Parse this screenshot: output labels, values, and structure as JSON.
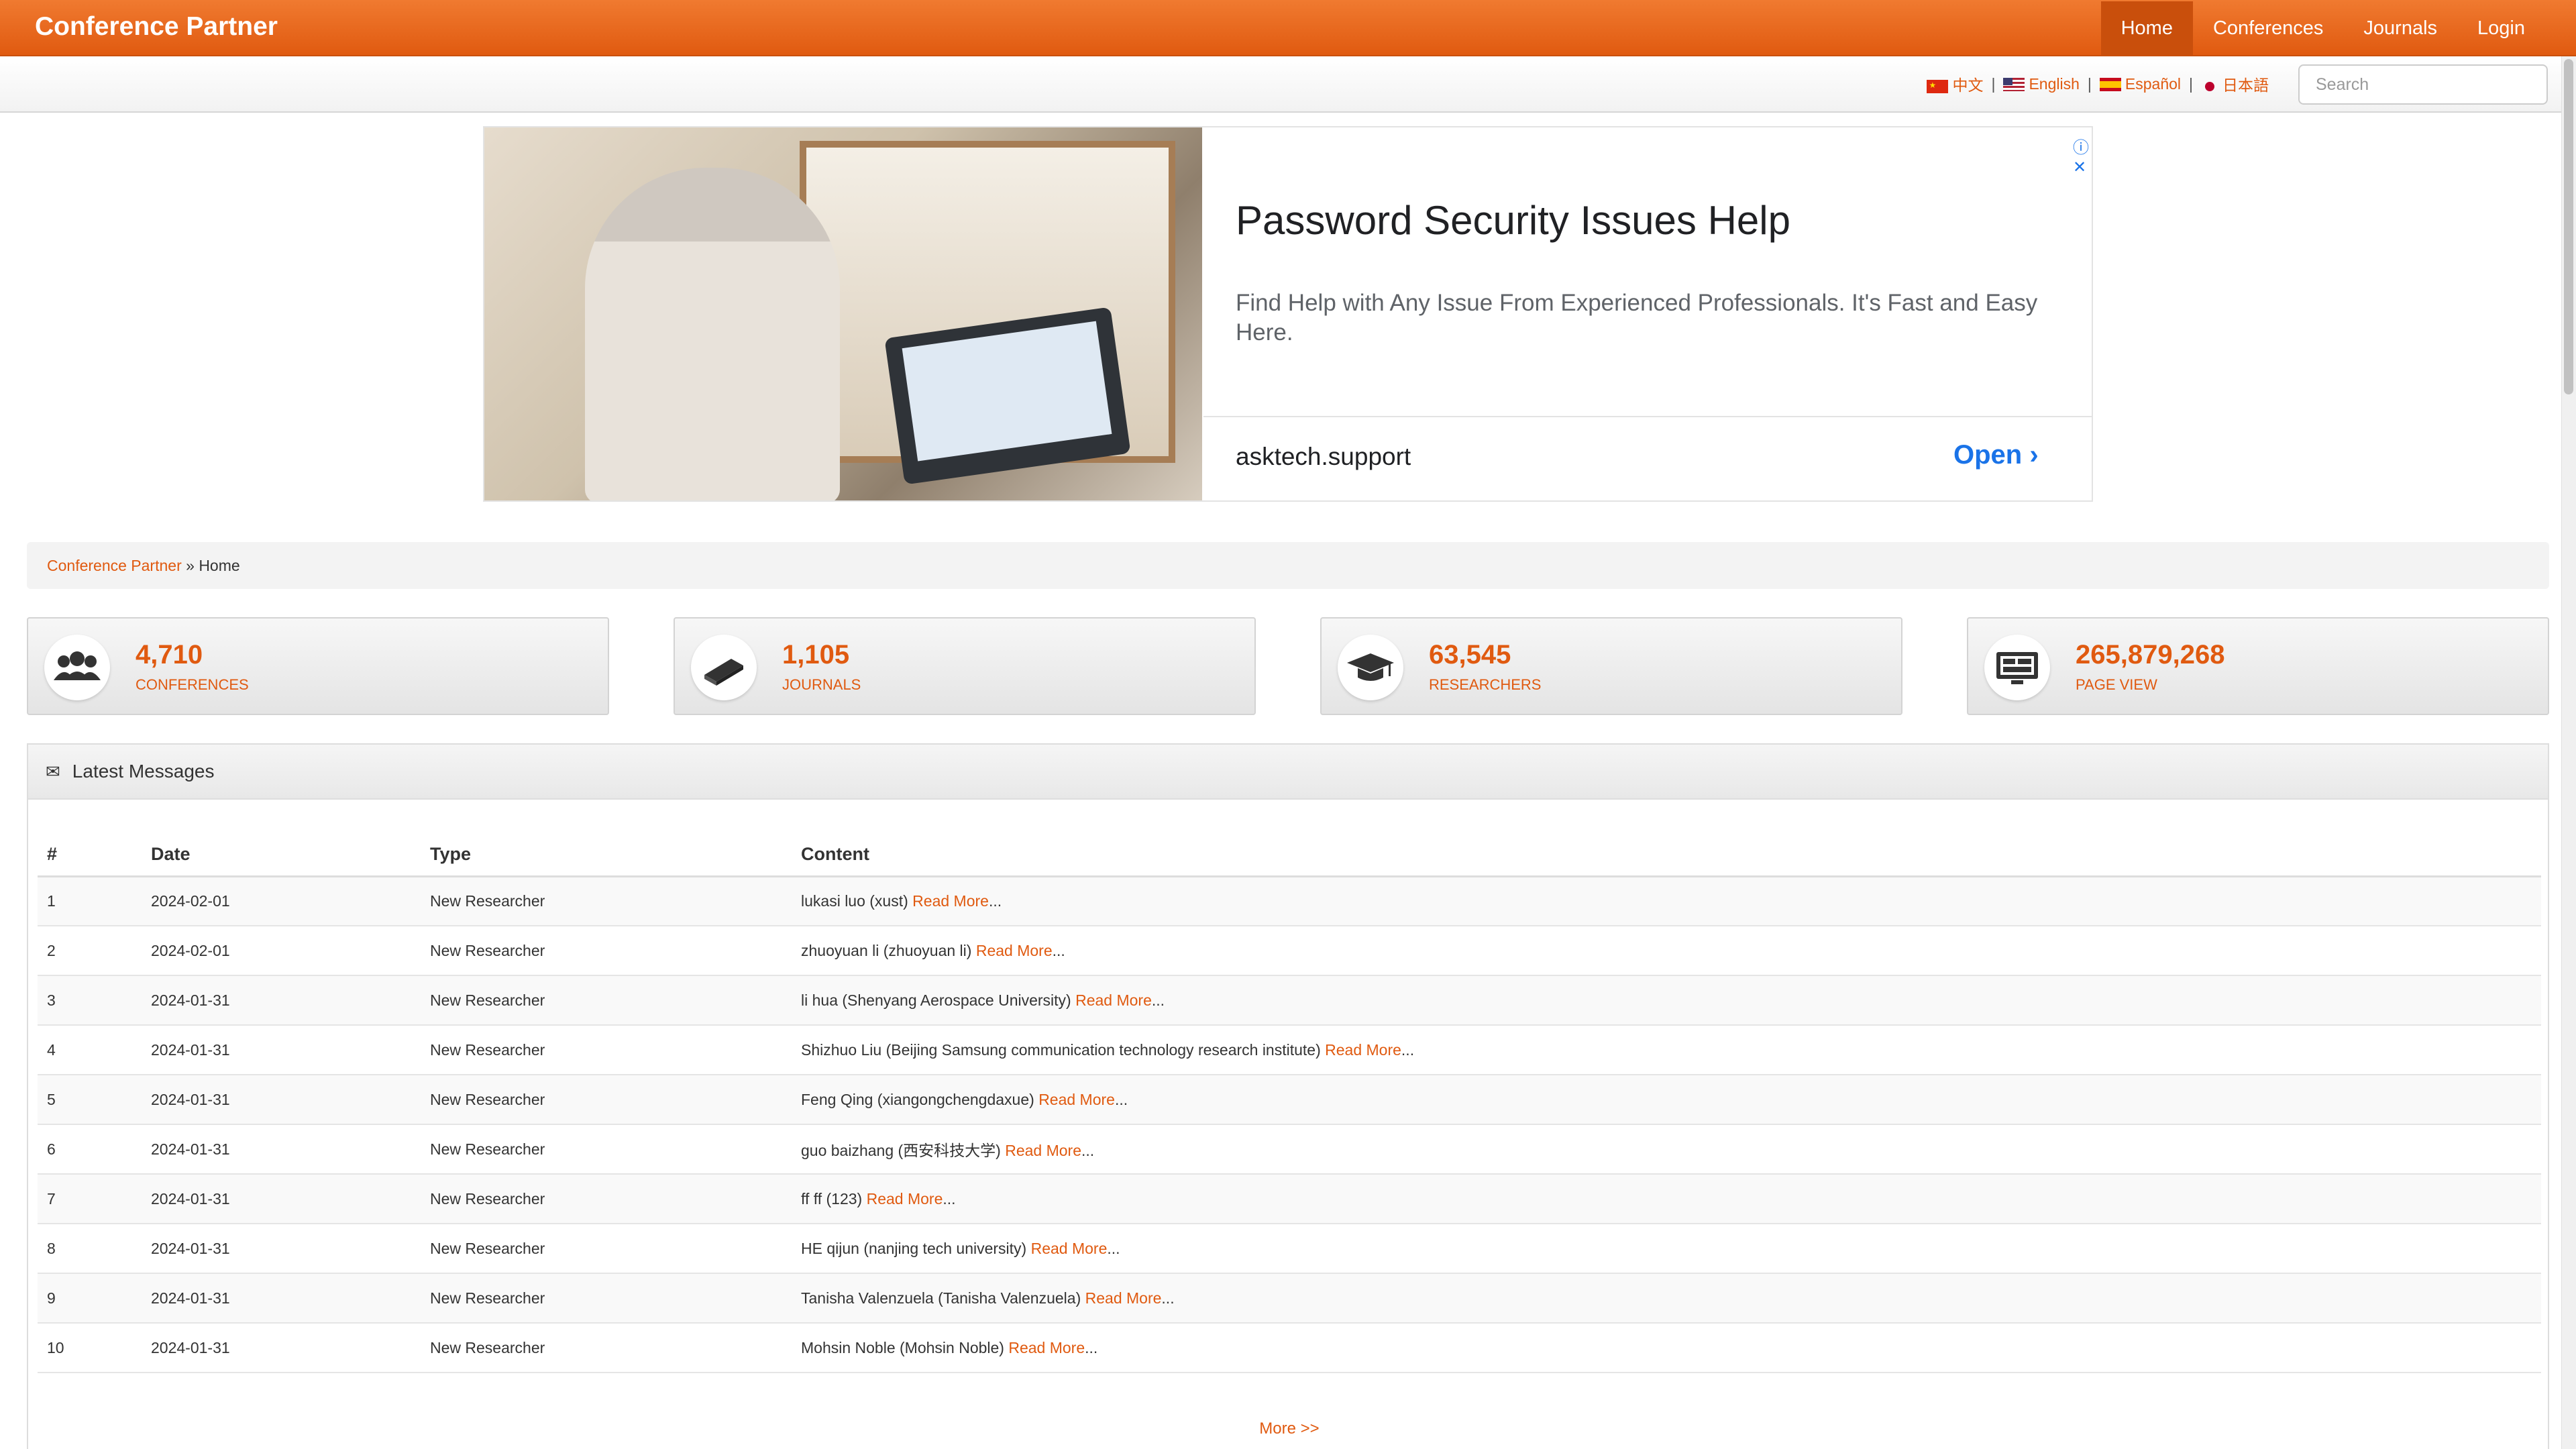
{
  "header": {
    "brand": "Conference Partner",
    "nav": [
      "Home",
      "Conferences",
      "Journals",
      "Login"
    ]
  },
  "languages": [
    "中文",
    "English",
    "Español",
    "日本語"
  ],
  "search": {
    "placeholder": "Search",
    "value": ""
  },
  "ad": {
    "title": "Password Security Issues Help",
    "description": "Find Help with Any Issue From Experienced Professionals. It's Fast and Easy Here.",
    "domain": "asktech.support",
    "cta": "Open"
  },
  "breadcrumb": {
    "root": "Conference Partner",
    "separator": "»",
    "current": "Home"
  },
  "stats": [
    {
      "value": "4,710",
      "label": "CONFERENCES",
      "icon": "group-icon"
    },
    {
      "value": "1,105",
      "label": "JOURNALS",
      "icon": "book-icon"
    },
    {
      "value": "63,545",
      "label": "RESEARCHERS",
      "icon": "graduation-cap-icon"
    },
    {
      "value": "265,879,268",
      "label": "PAGE VIEW",
      "icon": "monitor-icon"
    }
  ],
  "messages": {
    "title": "Latest Messages",
    "columns": [
      "#",
      "Date",
      "Type",
      "Content"
    ],
    "rows": [
      {
        "num": "1",
        "date": "2024-02-01",
        "type": "New Researcher",
        "content": "lukasi luo (xust)"
      },
      {
        "num": "2",
        "date": "2024-02-01",
        "type": "New Researcher",
        "content": "zhuoyuan li (zhuoyuan li)"
      },
      {
        "num": "3",
        "date": "2024-01-31",
        "type": "New Researcher",
        "content": "li hua (Shenyang Aerospace University)"
      },
      {
        "num": "4",
        "date": "2024-01-31",
        "type": "New Researcher",
        "content": "Shizhuo Liu (Beijing Samsung communication technology research institute)"
      },
      {
        "num": "5",
        "date": "2024-01-31",
        "type": "New Researcher",
        "content": "Feng Qing (xiangongchengdaxue)"
      },
      {
        "num": "6",
        "date": "2024-01-31",
        "type": "New Researcher",
        "content": "guo baizhang (西安科技大学)"
      },
      {
        "num": "7",
        "date": "2024-01-31",
        "type": "New Researcher",
        "content": "ff ff (123)"
      },
      {
        "num": "8",
        "date": "2024-01-31",
        "type": "New Researcher",
        "content": "HE qijun (nanjing tech university)"
      },
      {
        "num": "9",
        "date": "2024-01-31",
        "type": "New Researcher",
        "content": "Tanisha Valenzuela (Tanisha Valenzuela)"
      },
      {
        "num": "10",
        "date": "2024-01-31",
        "type": "New Researcher",
        "content": "Mohsin Noble (Mohsin Noble)"
      }
    ],
    "read_more": "Read More",
    "ellipsis": "...",
    "more_link": "More >>"
  },
  "colors": {
    "accent": "#e05a10",
    "nav_active": "#c94f0c",
    "ad_link": "#1a73e8"
  }
}
